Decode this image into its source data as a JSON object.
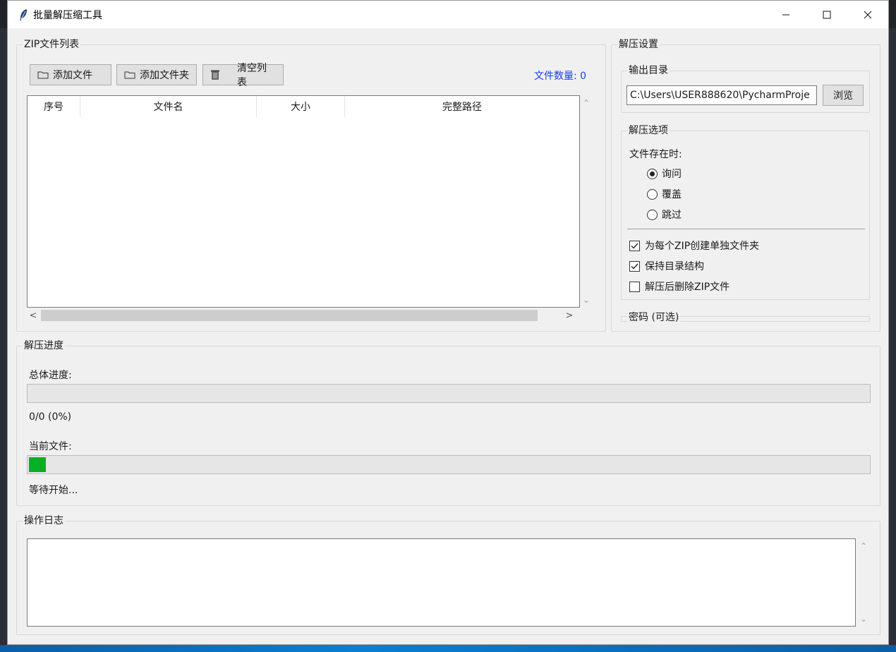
{
  "window": {
    "title": "批量解压缩工具",
    "minimize_glyph": "—",
    "maximize_glyph": "☐",
    "close_glyph": "✕"
  },
  "zip_list": {
    "label": "ZIP文件列表",
    "buttons": {
      "add_file": "添加文件",
      "add_folder": "添加文件夹",
      "clear_list": "清空列表"
    },
    "count_text": "文件数量: 0",
    "columns": [
      "序号",
      "文件名",
      "大小",
      "完整路径"
    ],
    "rows": []
  },
  "settings": {
    "label": "解压设置",
    "output": {
      "label": "输出目录",
      "value": "C:\\Users\\USER888620\\PycharmProje",
      "browse_label": "浏览"
    },
    "options": {
      "label": "解压选项",
      "conflict_label": "文件存在时:",
      "conflict_choices": [
        {
          "label": "询问",
          "selected": true
        },
        {
          "label": "覆盖",
          "selected": false
        },
        {
          "label": "跳过",
          "selected": false
        }
      ],
      "checks": [
        {
          "label": "为每个ZIP创建单独文件夹",
          "checked": true
        },
        {
          "label": "保持目录结构",
          "checked": true
        },
        {
          "label": "解压后删除ZIP文件",
          "checked": false
        }
      ]
    },
    "password_label": "密码 (可选)"
  },
  "progress": {
    "label": "解压进度",
    "overall_label": "总体进度:",
    "overall_value": 0,
    "overall_text": "0/0 (0%)",
    "current_label": "当前文件:",
    "current_value": 0.02,
    "status_text": "等待开始..."
  },
  "log": {
    "label": "操作日志",
    "content": ""
  },
  "colors": {
    "accent_count": "#1a3cf0",
    "progress_fill": "#06b025"
  },
  "icons": {
    "app": "feather-icon",
    "add_file": "folder-icon",
    "add_folder": "folder-icon",
    "clear_list": "trash-icon"
  }
}
